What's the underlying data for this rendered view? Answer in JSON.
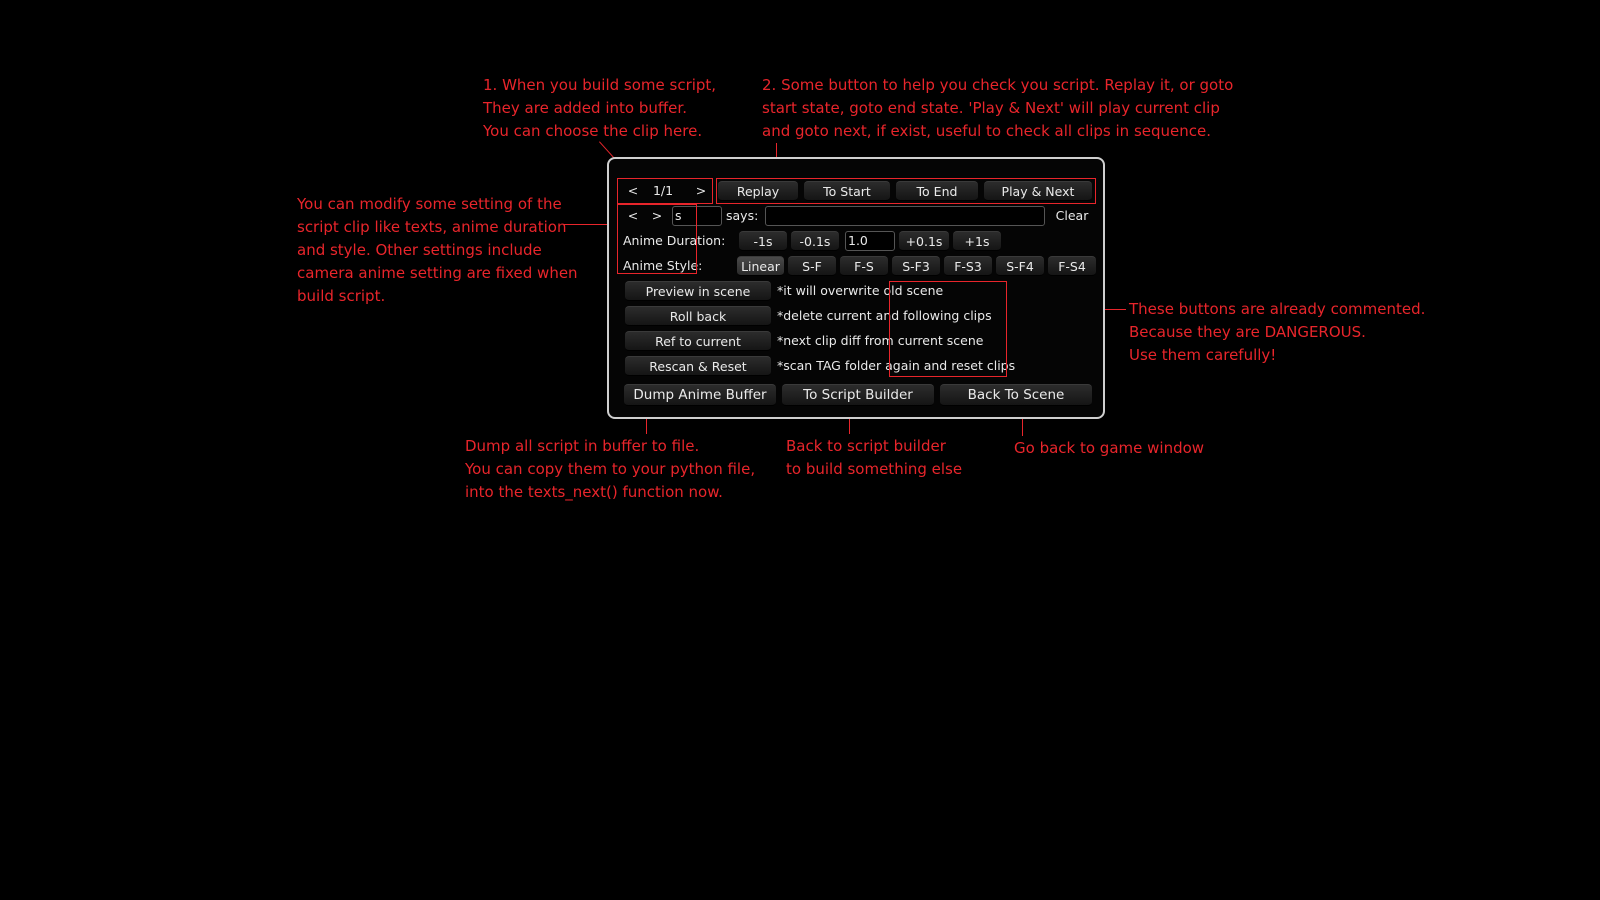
{
  "notes": {
    "buffer": "1. When you build some script,\nThey are added into buffer.\nYou can choose the clip here.",
    "check": "2. Some button to help you check you script. Replay it, or goto\nstart state, goto end state. 'Play & Next' will play current clip\nand goto next, if exist, useful to check all clips in sequence.",
    "modify": "You can modify some setting of the\nscript clip like texts, anime duration\nand style. Other settings include\ncamera anime setting are fixed when\nbuild script.",
    "dangerous": "These buttons are already commented.\nBecause they are DANGEROUS.\nUse them carefully!",
    "dump": "Dump all script in buffer to file.\nYou can copy them to your python file,\ninto the texts_next() function now.",
    "builder": "Back to script builder\nto build something else",
    "scene": "Go back to game window"
  },
  "clip_nav": {
    "prev": "<",
    "counter": "1/1",
    "next": ">"
  },
  "playback": {
    "replay": "Replay",
    "to_start": "To Start",
    "to_end": "To End",
    "play_next": "Play & Next"
  },
  "text_row": {
    "prev": "<",
    "next": ">",
    "speaker_value": "s",
    "says_label": "says:",
    "text_value": "",
    "clear": "Clear"
  },
  "duration": {
    "label": "Anime Duration:",
    "minus1": "-1s",
    "minus01": "-0.1s",
    "value": "1.0",
    "plus01": "+0.1s",
    "plus1": "+1s"
  },
  "style": {
    "label": "Anime Style:",
    "options": [
      "Linear",
      "S-F",
      "F-S",
      "S-F3",
      "F-S3",
      "S-F4",
      "F-S4"
    ],
    "selected": "Linear"
  },
  "danger": [
    {
      "button": "Preview in scene",
      "comment": "*it will overwrite old scene"
    },
    {
      "button": "Roll back",
      "comment": "*delete current and following clips"
    },
    {
      "button": "Ref to current",
      "comment": "*next clip diff from current scene"
    },
    {
      "button": "Rescan & Reset",
      "comment": "*scan TAG folder again and reset clips"
    }
  ],
  "bottom": {
    "dump": "Dump Anime Buffer",
    "builder": "To Script Builder",
    "back": "Back To Scene"
  },
  "colors": {
    "annotation": "#e8252b",
    "background": "#000000",
    "panel_border": "#cfcfcf"
  }
}
